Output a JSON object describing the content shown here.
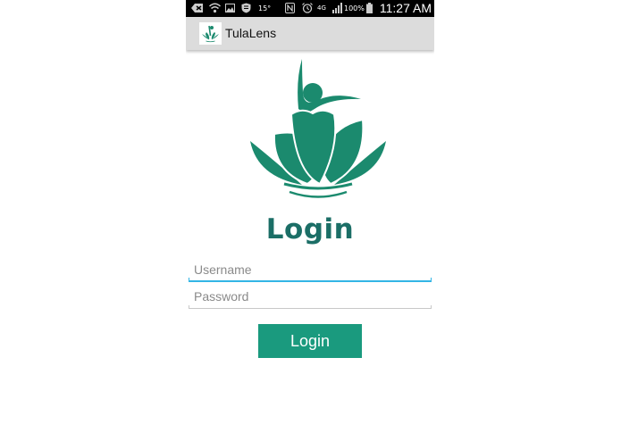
{
  "status_bar": {
    "battery_percent": "100%",
    "time": "11:27 AM",
    "temperature": "15°",
    "network": "4G",
    "icons": [
      "mail-icon",
      "wifi-icon",
      "image-icon",
      "shield-icon",
      "nfc-icon",
      "alarm-icon",
      "network-4g-icon",
      "signal-icon",
      "battery-icon"
    ]
  },
  "action_bar": {
    "title": "TulaLens",
    "icon": "lotus-logo-icon"
  },
  "main": {
    "logo": "lotus-logo-icon",
    "heading": "Login",
    "username_placeholder": "Username",
    "username_value": "",
    "password_placeholder": "Password",
    "password_value": "",
    "login_button_label": "Login"
  },
  "colors": {
    "brand": "#1b8a6e",
    "heading": "#1b6e66",
    "button": "#1a9a7e",
    "focus_underline": "#33b5e5"
  }
}
